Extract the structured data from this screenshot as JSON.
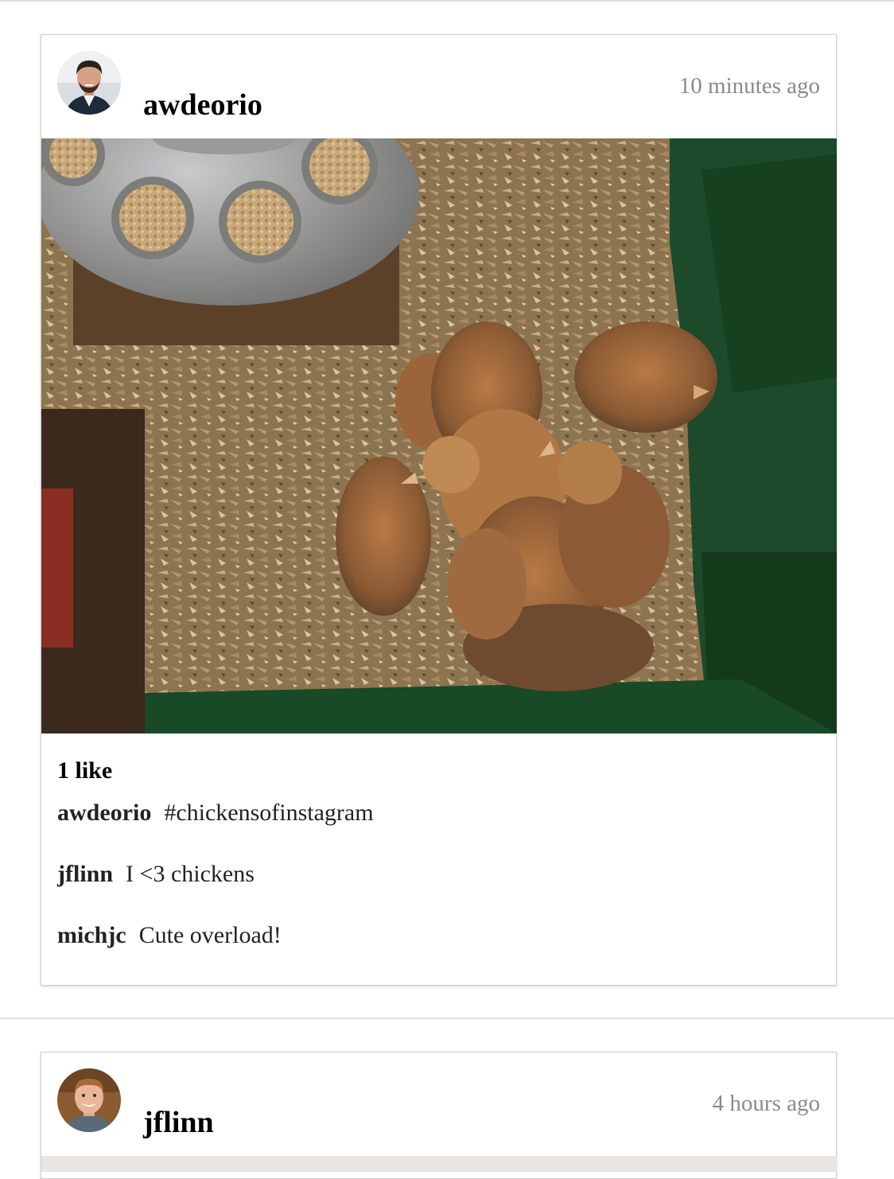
{
  "posts": [
    {
      "owner": "awdeorio",
      "timestamp": "10 minutes ago",
      "avatar_icon": "user-avatar-awdeorio",
      "image_icon": "chicks-photo",
      "likes_text": "1 like",
      "comments": [
        {
          "owner": "awdeorio",
          "text": "#chickensofinstagram"
        },
        {
          "owner": "jflinn",
          "text": "I <3 chickens"
        },
        {
          "owner": "michjc",
          "text": "Cute overload!"
        }
      ]
    },
    {
      "owner": "jflinn",
      "timestamp": "4 hours ago",
      "avatar_icon": "user-avatar-jflinn",
      "image_icon": "post-photo"
    }
  ],
  "colors": {
    "timestamp": "#8a8a8a",
    "divider": "#dcdcdc",
    "card_border": "#cfcfcf"
  }
}
